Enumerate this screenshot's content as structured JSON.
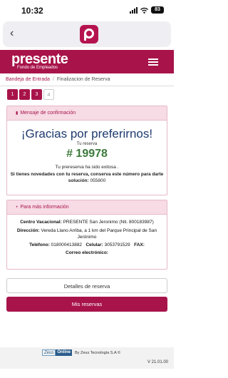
{
  "status_bar": {
    "time": "10:32",
    "battery": "83"
  },
  "header": {
    "brand": "presente",
    "tagline": "Fondo de Empleados"
  },
  "breadcrumb": {
    "home": "Bandeja de Entrada",
    "current": "Finalizacion de Reserva"
  },
  "steps": [
    "1",
    "2",
    "3",
    "4"
  ],
  "confirm_card": {
    "header": "Mensaje de confirmación",
    "title": "¡Gracias por preferirnos!",
    "reservation_label": "Tu reserva",
    "reservation_number": "# 19978",
    "success_text": "Tu prereserva ha sido exitosa .",
    "help_text": "Si tienes novedades con tu reserva, conserva este número para darte solución:",
    "help_code": "055800"
  },
  "info_card": {
    "header": "Para más información",
    "center_label": "Centro Vacacional:",
    "center_value": "PRESENTE San Jeronimo (Nit. 800183987)",
    "address_label": "Dirección:",
    "address_value": "Vereda Llano Arriba, a 1 km del Parque Principal de San Jerónimo",
    "phone_label": "Teléfono:",
    "phone_value": "018000413882",
    "cell_label": "Celular:",
    "cell_value": "3053791529",
    "fax_label": "FAX:",
    "fax_value": "",
    "email_label": "Correo electrónico:",
    "email_value": ""
  },
  "buttons": {
    "details": "Detalles de reserva",
    "my_reservations": "Mis reservas"
  },
  "footer": {
    "zeus": "Zeus",
    "online": "Online",
    "by_text": "By Zeus Tecnología S.A ©",
    "version": "V 21.01.00"
  }
}
